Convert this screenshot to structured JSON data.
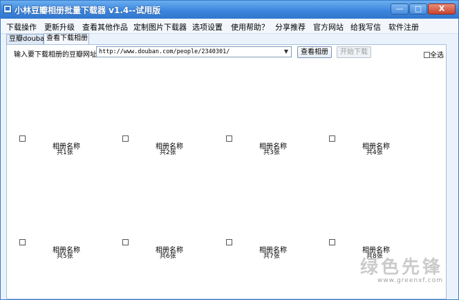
{
  "window": {
    "title": "小林豆瓣相册批量下载器 v1.4--试用版",
    "buttons": {
      "minimize": "—",
      "maximize": "□",
      "close": "X"
    }
  },
  "menu": {
    "items": [
      "下载操作",
      "更新升级",
      "查看其他作品",
      "定制图片下载器",
      "选项设置",
      "使用帮助？",
      "分享推荐",
      "官方网站",
      "给我写信",
      "软件注册"
    ]
  },
  "tabs": [
    {
      "label": "豆瓣douban",
      "active": false
    },
    {
      "label": "查看下载相册",
      "active": true
    }
  ],
  "toolbar": {
    "url_label": "输入要下载相册的豆瓣网址:",
    "url_value": "http://www.douban.com/people/2340301/",
    "view_button": "查看相册",
    "download_button": "开始下载",
    "select_all_label": "全选"
  },
  "albums": [
    {
      "name": "相册名称",
      "count": "共1张"
    },
    {
      "name": "相册名称",
      "count": "共2张"
    },
    {
      "name": "相册名称",
      "count": "共3张"
    },
    {
      "name": "相册名称",
      "count": "共4张"
    },
    {
      "name": "相册名称",
      "count": "共5张"
    },
    {
      "name": "相册名称",
      "count": "共6张"
    },
    {
      "name": "相册名称",
      "count": "共7张"
    },
    {
      "name": "相册名称",
      "count": "共8张"
    }
  ],
  "watermark": {
    "main": "绿色先锋",
    "url": "www.greenxf.com"
  }
}
